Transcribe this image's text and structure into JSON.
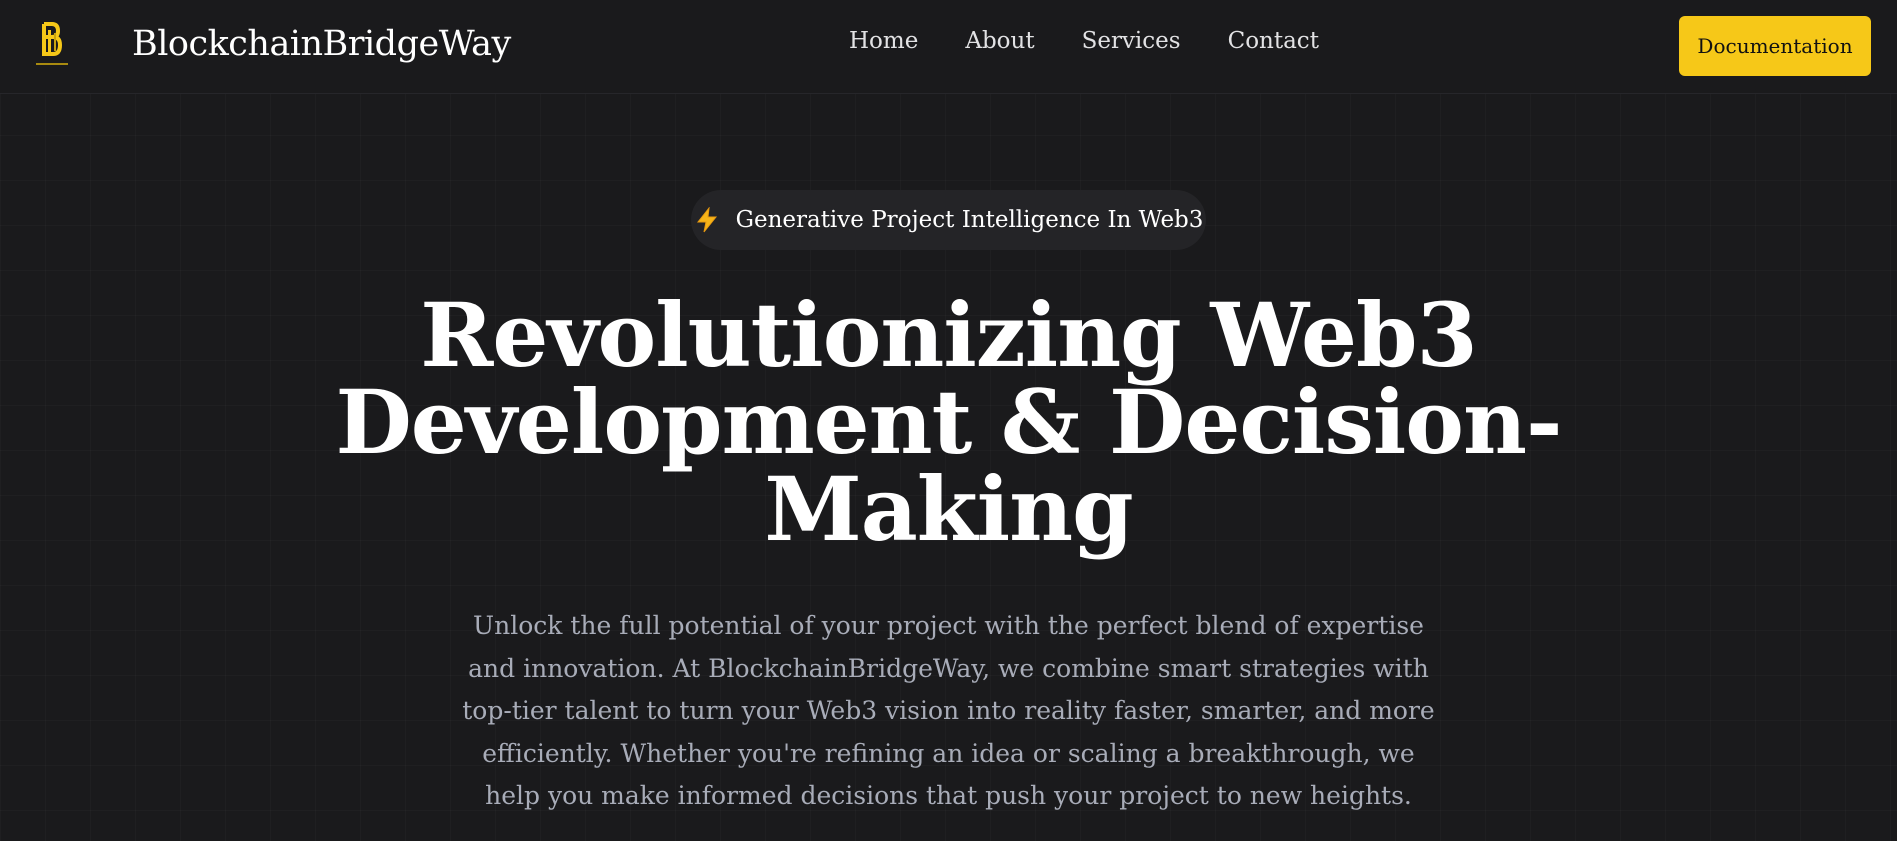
{
  "brand": {
    "name": "BlockchainBridgeWay",
    "logo_icon": "bridge-logo-icon",
    "logo_color": "#f6c818"
  },
  "nav": {
    "items": [
      {
        "label": "Home"
      },
      {
        "label": "About"
      },
      {
        "label": "Services"
      },
      {
        "label": "Contact"
      }
    ],
    "cta_label": "Documentation"
  },
  "hero": {
    "badge_icon": "lightning-icon",
    "badge_text": "Generative Project Intelligence In Web3",
    "headline": "Revolutionizing Web3 Development & Decision-Making",
    "description": "Unlock the full potential of your project with the perfect blend of expertise and innovation. At BlockchainBridgeWay, we combine smart strategies with top-tier talent to turn your Web3 vision into reality faster, smarter, and more efficiently. Whether you're refining an idea or scaling a breakthrough, we help you make informed decisions that push your project to new heights."
  },
  "colors": {
    "background": "#1a1a1c",
    "accent": "#f6c818",
    "text_primary": "#ffffff",
    "text_muted": "#a8acb8"
  }
}
